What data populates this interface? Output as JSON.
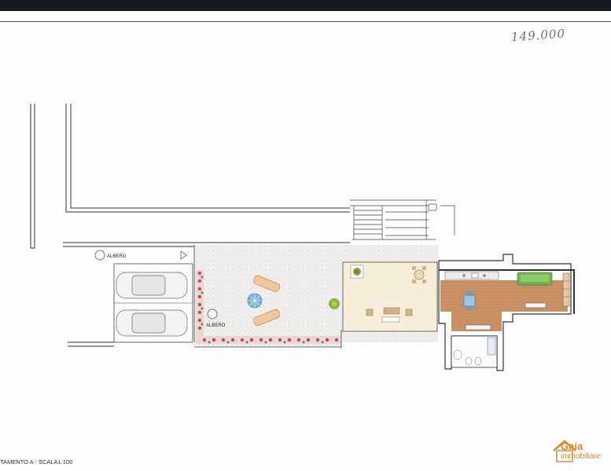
{
  "header_note": "149.000",
  "labels": {
    "tree_1": "ALBERO",
    "tree_2": "ALBERO"
  },
  "footer": {
    "caption": "TAMENTO A - SCALA1:100"
  },
  "logo": {
    "line1": "Gaia",
    "line2": "immobiliare"
  },
  "colors": {
    "floor_wood": "#c89063",
    "terrace": "#f6eed8",
    "garden_gravel": "#ecebea",
    "sofa": "#74b552",
    "brand": "#d9892b"
  }
}
